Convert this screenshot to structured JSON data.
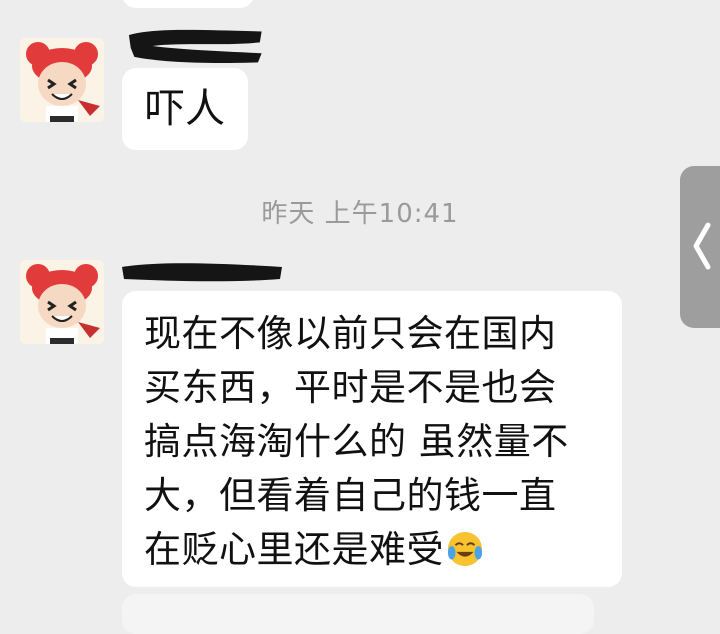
{
  "chat": {
    "messages": [
      {
        "sender_redacted": true,
        "text": "吓人"
      },
      {
        "sender_redacted": true,
        "lines": [
          "现在不像以前只会在国内",
          "买东西，平时是不是也会",
          "搞点海淘什么的 虽然量不",
          "大，但看着自己的钱一直",
          "在贬心里还是难受"
        ],
        "emoji": "face-with-tears-of-joy"
      }
    ],
    "timestamp": "昨天 上午10:41"
  },
  "icons": {
    "side_handle": "chevron-left-icon"
  },
  "colors": {
    "background": "#ededed",
    "bubble": "#ffffff",
    "timestamp": "#9a9a9a",
    "handle": "#9e9e9e"
  }
}
